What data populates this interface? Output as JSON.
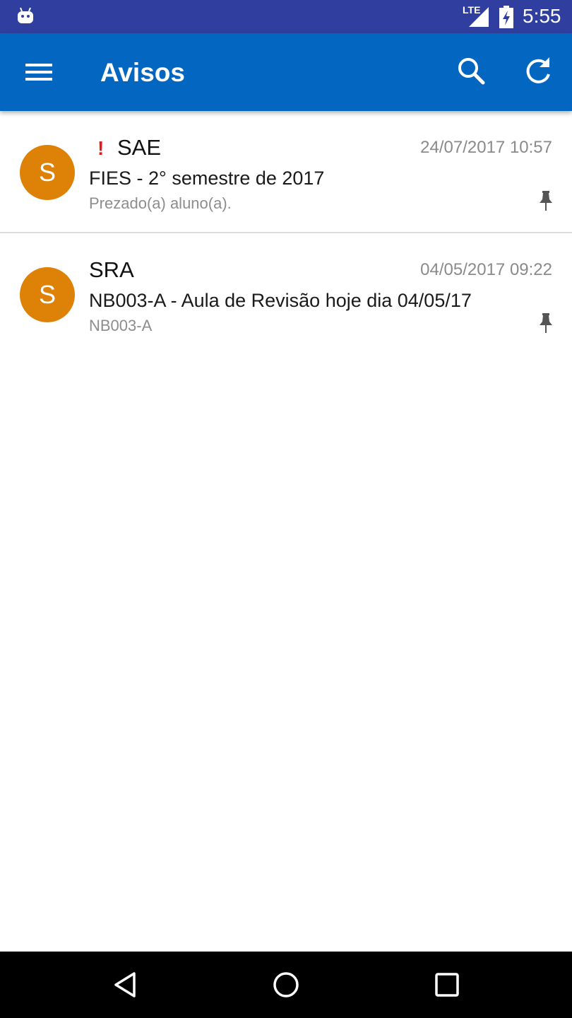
{
  "status_bar": {
    "network_label": "LTE",
    "time": "5:55",
    "icons": [
      "android-icon",
      "signal-icon",
      "battery-charging-icon"
    ]
  },
  "app_bar": {
    "title": "Avisos",
    "color": "#0367c1",
    "icons": [
      "menu-icon",
      "search-icon",
      "refresh-icon"
    ]
  },
  "notices": [
    {
      "avatar_letter": "S",
      "important": true,
      "flag": "!",
      "sender": "SAE",
      "date": "24/07/2017 10:57",
      "subject": "FIES - 2° semestre de 2017",
      "preview": "Prezado(a) aluno(a)."
    },
    {
      "avatar_letter": "S",
      "important": false,
      "sender": "SRA",
      "date": "04/05/2017 09:22",
      "subject": "NB003-A - Aula de Revisão hoje dia 04/05/17",
      "preview": "NB003-A"
    }
  ],
  "colors": {
    "status_bar": "#303f9f",
    "avatar": "#de8207",
    "important_flag": "#e11a1a"
  },
  "nav_bar": {
    "icons": [
      "back-icon",
      "home-icon",
      "recents-icon"
    ]
  }
}
